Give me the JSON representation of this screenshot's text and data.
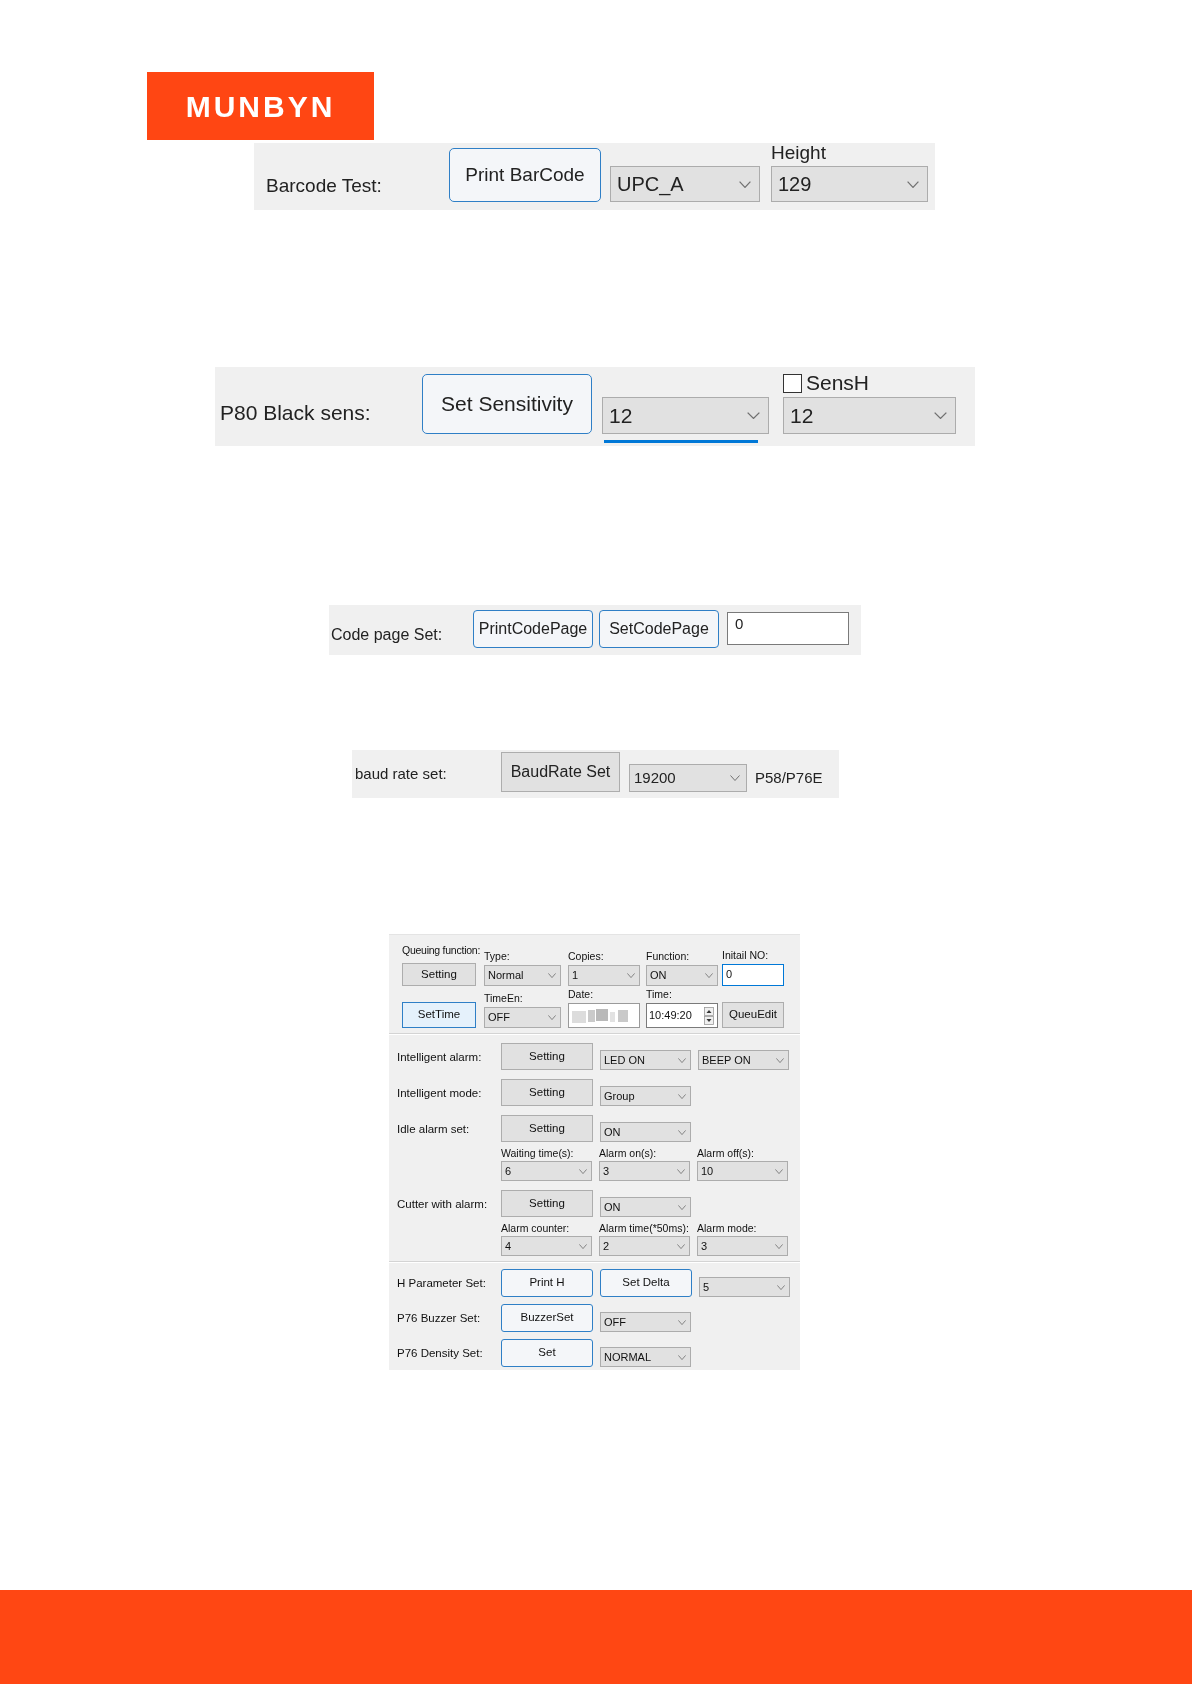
{
  "logo": {
    "text": "MUNBYN"
  },
  "barcode_test": {
    "label": "Barcode Test:",
    "button": {
      "label": "Print BarCode",
      "highlighted": true,
      "hovered": false
    },
    "type": {
      "value": "UPC_A"
    },
    "height": {
      "caption": "Height",
      "value": "129"
    }
  },
  "sensitivity": {
    "label": "P80 Black sens:",
    "button": {
      "label": "Set Sensitivity",
      "highlighted": true,
      "hovered": false
    },
    "black_sens": {
      "value": "12",
      "focused": true
    },
    "sens_h": {
      "label": "SensH",
      "checked": false,
      "value": "12"
    }
  },
  "code_page": {
    "label": "Code page Set:",
    "buttons": [
      {
        "label": "PrintCodePage",
        "highlighted": true,
        "hovered": false
      },
      {
        "label": "SetCodePage",
        "highlighted": true,
        "hovered": false
      }
    ],
    "input": {
      "value": "0"
    }
  },
  "baud_rate": {
    "label": "baud rate set:",
    "button": {
      "label": "BaudRate Set",
      "highlighted": false,
      "hovered": false
    },
    "select": {
      "value": "19200"
    },
    "note": "P58/P76E"
  },
  "settings_panel": {
    "queue_rows": [
      [
        {
          "kind": "button",
          "caption": "Queuing function:",
          "label": "Setting",
          "highlighted": false,
          "hovered": false
        },
        {
          "kind": "select",
          "caption": "Type:",
          "value": "Normal"
        },
        {
          "kind": "select",
          "caption": "Copies:",
          "value": "1"
        },
        {
          "kind": "select",
          "caption": "Function:",
          "value": "ON"
        },
        {
          "kind": "input",
          "caption": "Initail NO:",
          "value": "0",
          "focused": true
        }
      ],
      [
        {
          "kind": "button",
          "label": "SetTime",
          "highlighted": true,
          "hovered": true
        },
        {
          "kind": "select",
          "caption": "TimeEn:",
          "value": "OFF"
        },
        {
          "kind": "date",
          "caption": "Date:",
          "redacted": true
        },
        {
          "kind": "time",
          "caption": "Time:",
          "value": "10:49:20"
        },
        {
          "kind": "button",
          "label": "QueuEdit",
          "highlighted": false,
          "hovered": false
        }
      ]
    ],
    "alarm_rows": [
      {
        "label": "Intelligent alarm:",
        "controls": [
          {
            "kind": "button",
            "label": "Setting",
            "highlighted": false,
            "hovered": false
          },
          {
            "kind": "select",
            "value": "LED ON"
          },
          {
            "kind": "select",
            "value": "BEEP ON"
          }
        ]
      },
      {
        "label": "Intelligent mode:",
        "controls": [
          {
            "kind": "button",
            "label": "Setting",
            "highlighted": false,
            "hovered": false
          },
          {
            "kind": "select",
            "value": "Group"
          }
        ]
      },
      {
        "label": "Idle alarm set:",
        "controls": [
          {
            "kind": "button",
            "label": "Setting",
            "highlighted": false,
            "hovered": false
          },
          {
            "kind": "select",
            "value": "ON"
          }
        ],
        "details": [
          {
            "caption": "Waiting time(s):",
            "value": "6"
          },
          {
            "caption": "Alarm on(s):",
            "value": "3"
          },
          {
            "caption": "Alarm off(s):",
            "value": "10"
          }
        ]
      },
      {
        "label": "Cutter with alarm:",
        "controls": [
          {
            "kind": "button",
            "label": "Setting",
            "highlighted": false,
            "hovered": false
          },
          {
            "kind": "select",
            "value": "ON"
          }
        ],
        "details": [
          {
            "caption": "Alarm counter:",
            "value": "4"
          },
          {
            "caption": "Alarm time(*50ms):",
            "value": "2"
          },
          {
            "caption": "Alarm mode:",
            "value": "3"
          }
        ]
      }
    ],
    "parameter_rows": [
      {
        "label": "H Parameter Set:",
        "controls": [
          {
            "kind": "button",
            "label": "Print H",
            "highlighted": true,
            "hovered": false
          },
          {
            "kind": "button",
            "label": "Set Delta",
            "highlighted": true,
            "hovered": false
          },
          {
            "kind": "select",
            "value": "5"
          }
        ]
      },
      {
        "label": "P76 Buzzer Set:",
        "controls": [
          {
            "kind": "button",
            "label": "BuzzerSet",
            "highlighted": true,
            "hovered": false
          },
          {
            "kind": "select",
            "value": "OFF"
          }
        ]
      },
      {
        "label": "P76 Density Set:",
        "controls": [
          {
            "kind": "button",
            "label": "Set",
            "highlighted": true,
            "hovered": false
          },
          {
            "kind": "select",
            "value": "NORMAL"
          }
        ]
      }
    ]
  }
}
